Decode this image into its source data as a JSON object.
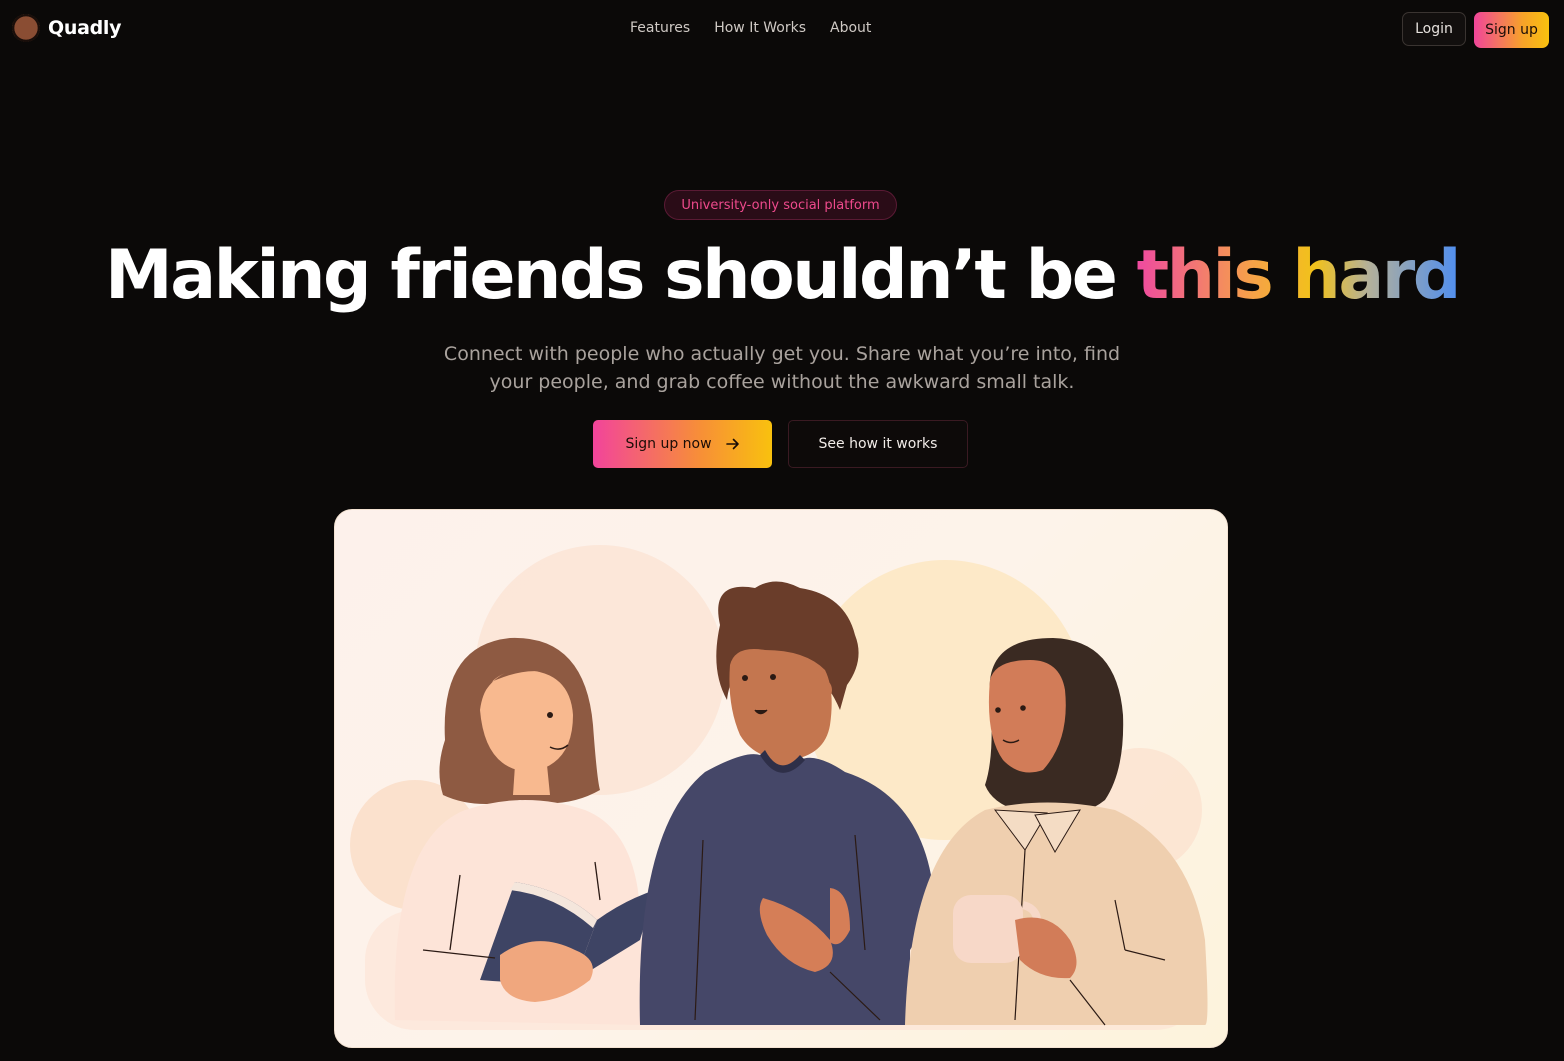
{
  "brand": {
    "name": "Quadly"
  },
  "nav": {
    "links": [
      "Features",
      "How It Works",
      "About"
    ],
    "login_label": "Login",
    "signup_label": "Sign up"
  },
  "hero": {
    "badge": "University-only social platform",
    "headline_plain": "Making friends shouldn’t be ",
    "headline_gradient": "this hard",
    "subtext": "Connect with people who actually get you. Share what you’re into, find your people, and grab coffee without the awkward small talk.",
    "primary_cta": "Sign up now",
    "primary_cta_icon": "arrow-right-icon",
    "secondary_cta": "See how it works"
  },
  "colors": {
    "background": "#0b0908",
    "accent_pink": "#f0459a",
    "accent_orange": "#f7a229",
    "accent_yellow": "#f9c10e",
    "accent_blue": "#4f8ef0",
    "badge_text": "#ee4a8c"
  },
  "illustration": {
    "description_icon": "three-friends-illustration"
  }
}
